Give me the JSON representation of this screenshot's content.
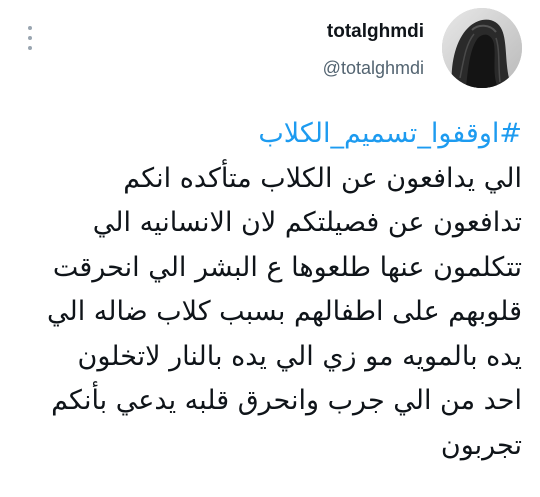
{
  "author": {
    "display_name": "totalghmdi",
    "handle": "@totalghmdi",
    "avatar_icon": "avatar-photo"
  },
  "tweet": {
    "hashtag": "#اوقفوا_تسميم_الكلاب",
    "lines": [
      "الي يدافعون عن الكلاب متأكده انكم",
      "تدافعون عن فصيلتكم لان الانسانيه الي",
      "تتكلمون عنها طلعوها ع البشر الي انحرقت",
      "قلوبهم على اطفالهم بسبب كلاب ضاله الي",
      "يده بالمويه مو زي الي يده بالنار لاتخلون",
      "احد من الي جرب وانحرق قلبه يدعي بأنكم",
      "تجربون"
    ]
  },
  "colors": {
    "hashtag": "#1d9bf0",
    "text": "#0f1419",
    "muted": "#536471"
  }
}
